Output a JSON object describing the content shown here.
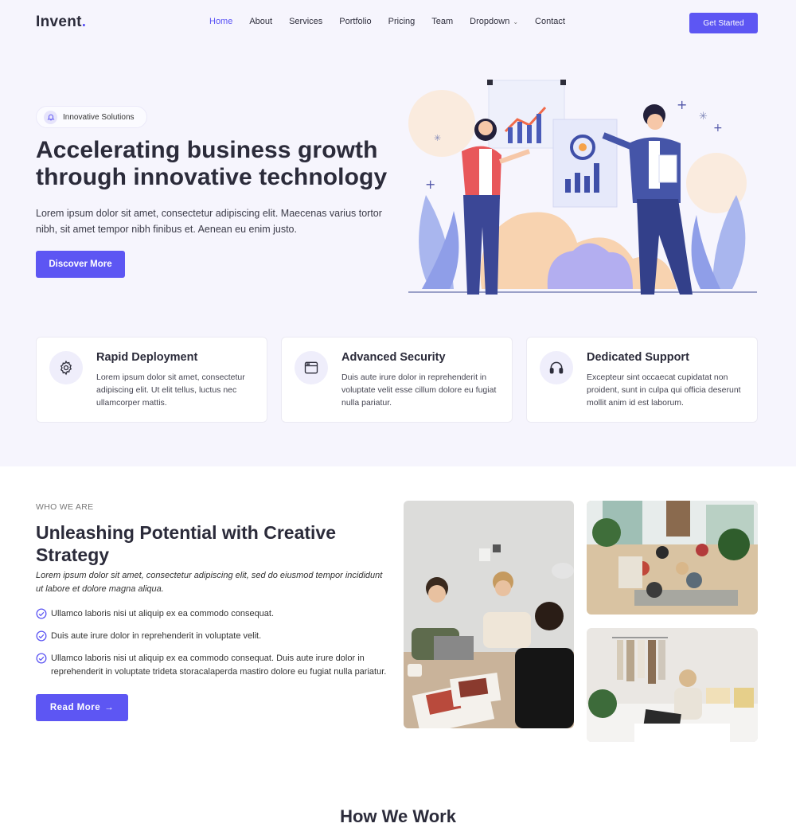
{
  "header": {
    "logo": "Invent",
    "logo_dot": ".",
    "nav": [
      "Home",
      "About",
      "Services",
      "Portfolio",
      "Pricing",
      "Team",
      "Dropdown",
      "Contact"
    ],
    "cta": "Get Started"
  },
  "hero": {
    "badge": "Innovative Solutions",
    "title": "Accelerating business growth through innovative technology",
    "text": "Lorem ipsum dolor sit amet, consectetur adipiscing elit. Maecenas varius tortor nibh, sit amet tempor nibh finibus et. Aenean eu enim justo.",
    "button": "Discover More"
  },
  "features": [
    {
      "icon": "gear-icon",
      "title": "Rapid Deployment",
      "text": "Lorem ipsum dolor sit amet, consectetur adipiscing elit. Ut elit tellus, luctus nec ullamcorper mattis."
    },
    {
      "icon": "browser-window-icon",
      "title": "Advanced Security",
      "text": "Duis aute irure dolor in reprehenderit in voluptate velit esse cillum dolore eu fugiat nulla pariatur."
    },
    {
      "icon": "headset-icon",
      "title": "Dedicated Support",
      "text": "Excepteur sint occaecat cupidatat non proident, sunt in culpa qui officia deserunt mollit anim id est laborum."
    }
  ],
  "about": {
    "eyebrow": "WHO WE ARE",
    "title": "Unleashing Potential with Creative Strategy",
    "lead": "Lorem ipsum dolor sit amet, consectetur adipiscing elit, sed do eiusmod tempor incididunt ut labore et dolore magna aliqua.",
    "items": [
      "Ullamco laboris nisi ut aliquip ex ea commodo consequat.",
      "Duis aute irure dolor in reprehenderit in voluptate velit.",
      "Ullamco laboris nisi ut aliquip ex ea commodo consequat. Duis aute irure dolor in reprehenderit in voluptate trideta storacalaperda mastiro dolore eu fugiat nulla pariatur."
    ],
    "button": "Read More",
    "button_icon": "→"
  },
  "how": {
    "title": "How We Work"
  },
  "colors": {
    "accent": "#5d56f3",
    "hero_bg": "#f6f5fd",
    "text": "#2b2b3a"
  }
}
